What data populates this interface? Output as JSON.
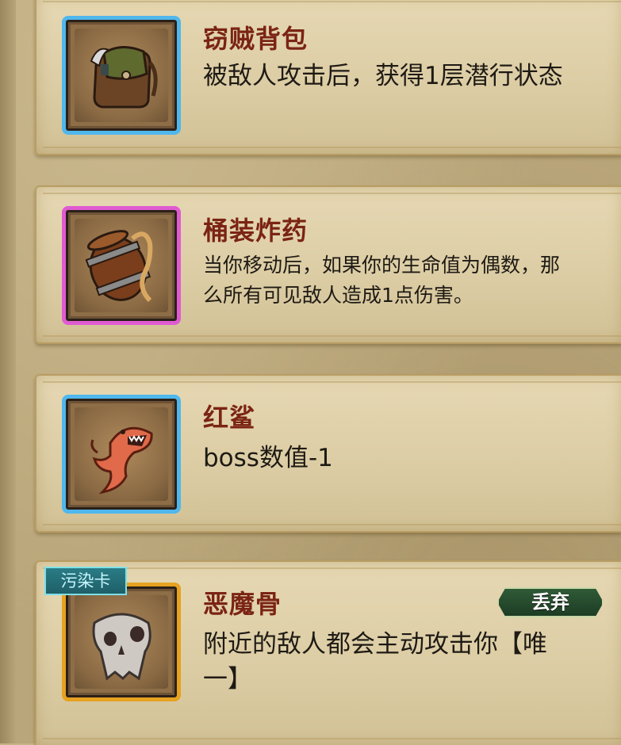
{
  "cards": [
    {
      "name": "窃贼背包",
      "desc": "被敌人攻击后，获得1层潜行状态",
      "frame_color": "blue",
      "icon": "thief-backpack-icon"
    },
    {
      "name": "桶装炸药",
      "desc": "当你移动后，如果你的生命值为偶数，那么所有可见敌人造成1点伤害。",
      "frame_color": "pink",
      "icon": "powder-barrel-icon"
    },
    {
      "name": "红鲨",
      "desc": "boss数值-1",
      "frame_color": "blue",
      "icon": "red-shark-icon"
    },
    {
      "name": "恶魔骨",
      "desc": "附近的敌人都会主动攻击你【唯一】",
      "frame_color": "gold",
      "icon": "demon-skull-icon",
      "tag": "污染卡",
      "discard_label": "丢弃"
    }
  ],
  "colors": {
    "title": "#7b2413",
    "text": "#1e1a14",
    "frame_blue": "#4fb7ec",
    "frame_pink": "#e05bd2",
    "frame_gold": "#e6a220",
    "tag_bg": "#2a7c85",
    "discard_bg": "#2f5a37"
  }
}
